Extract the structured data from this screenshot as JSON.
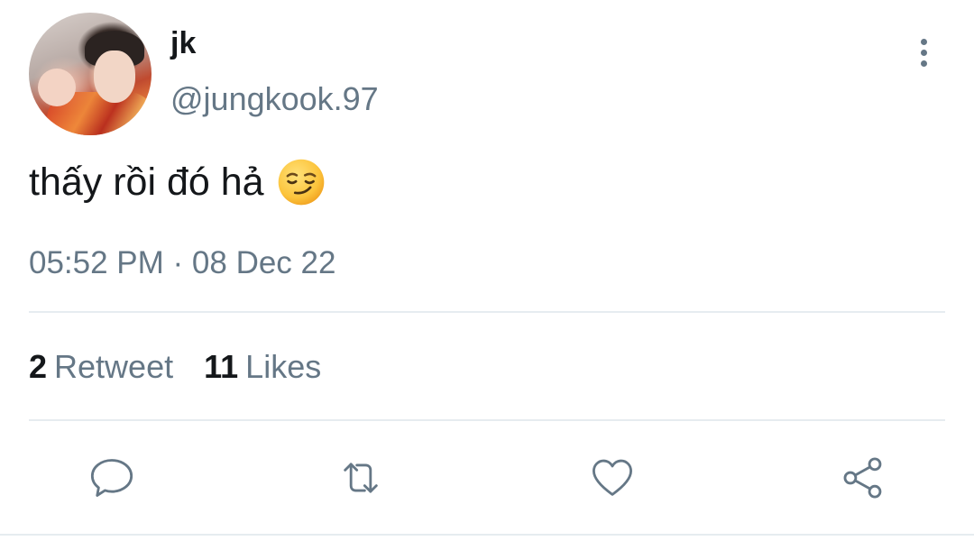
{
  "tweet": {
    "display_name": "jk",
    "handle": "@jungkook.97",
    "text": "thấy rồi đó hả",
    "emoji": "smirking-face-emoji",
    "timestamp": "05:52 PM · 08 Dec 22"
  },
  "stats": {
    "retweets": {
      "count": "2",
      "label": "Retweet"
    },
    "likes": {
      "count": "11",
      "label": "Likes"
    }
  },
  "actions": {
    "reply_icon": "reply-icon",
    "retweet_icon": "retweet-icon",
    "like_icon": "heart-icon",
    "share_icon": "share-icon"
  },
  "colors": {
    "text_primary": "#14171a",
    "text_secondary": "#657786",
    "divider": "#e6ecf0",
    "background": "#ffffff"
  }
}
